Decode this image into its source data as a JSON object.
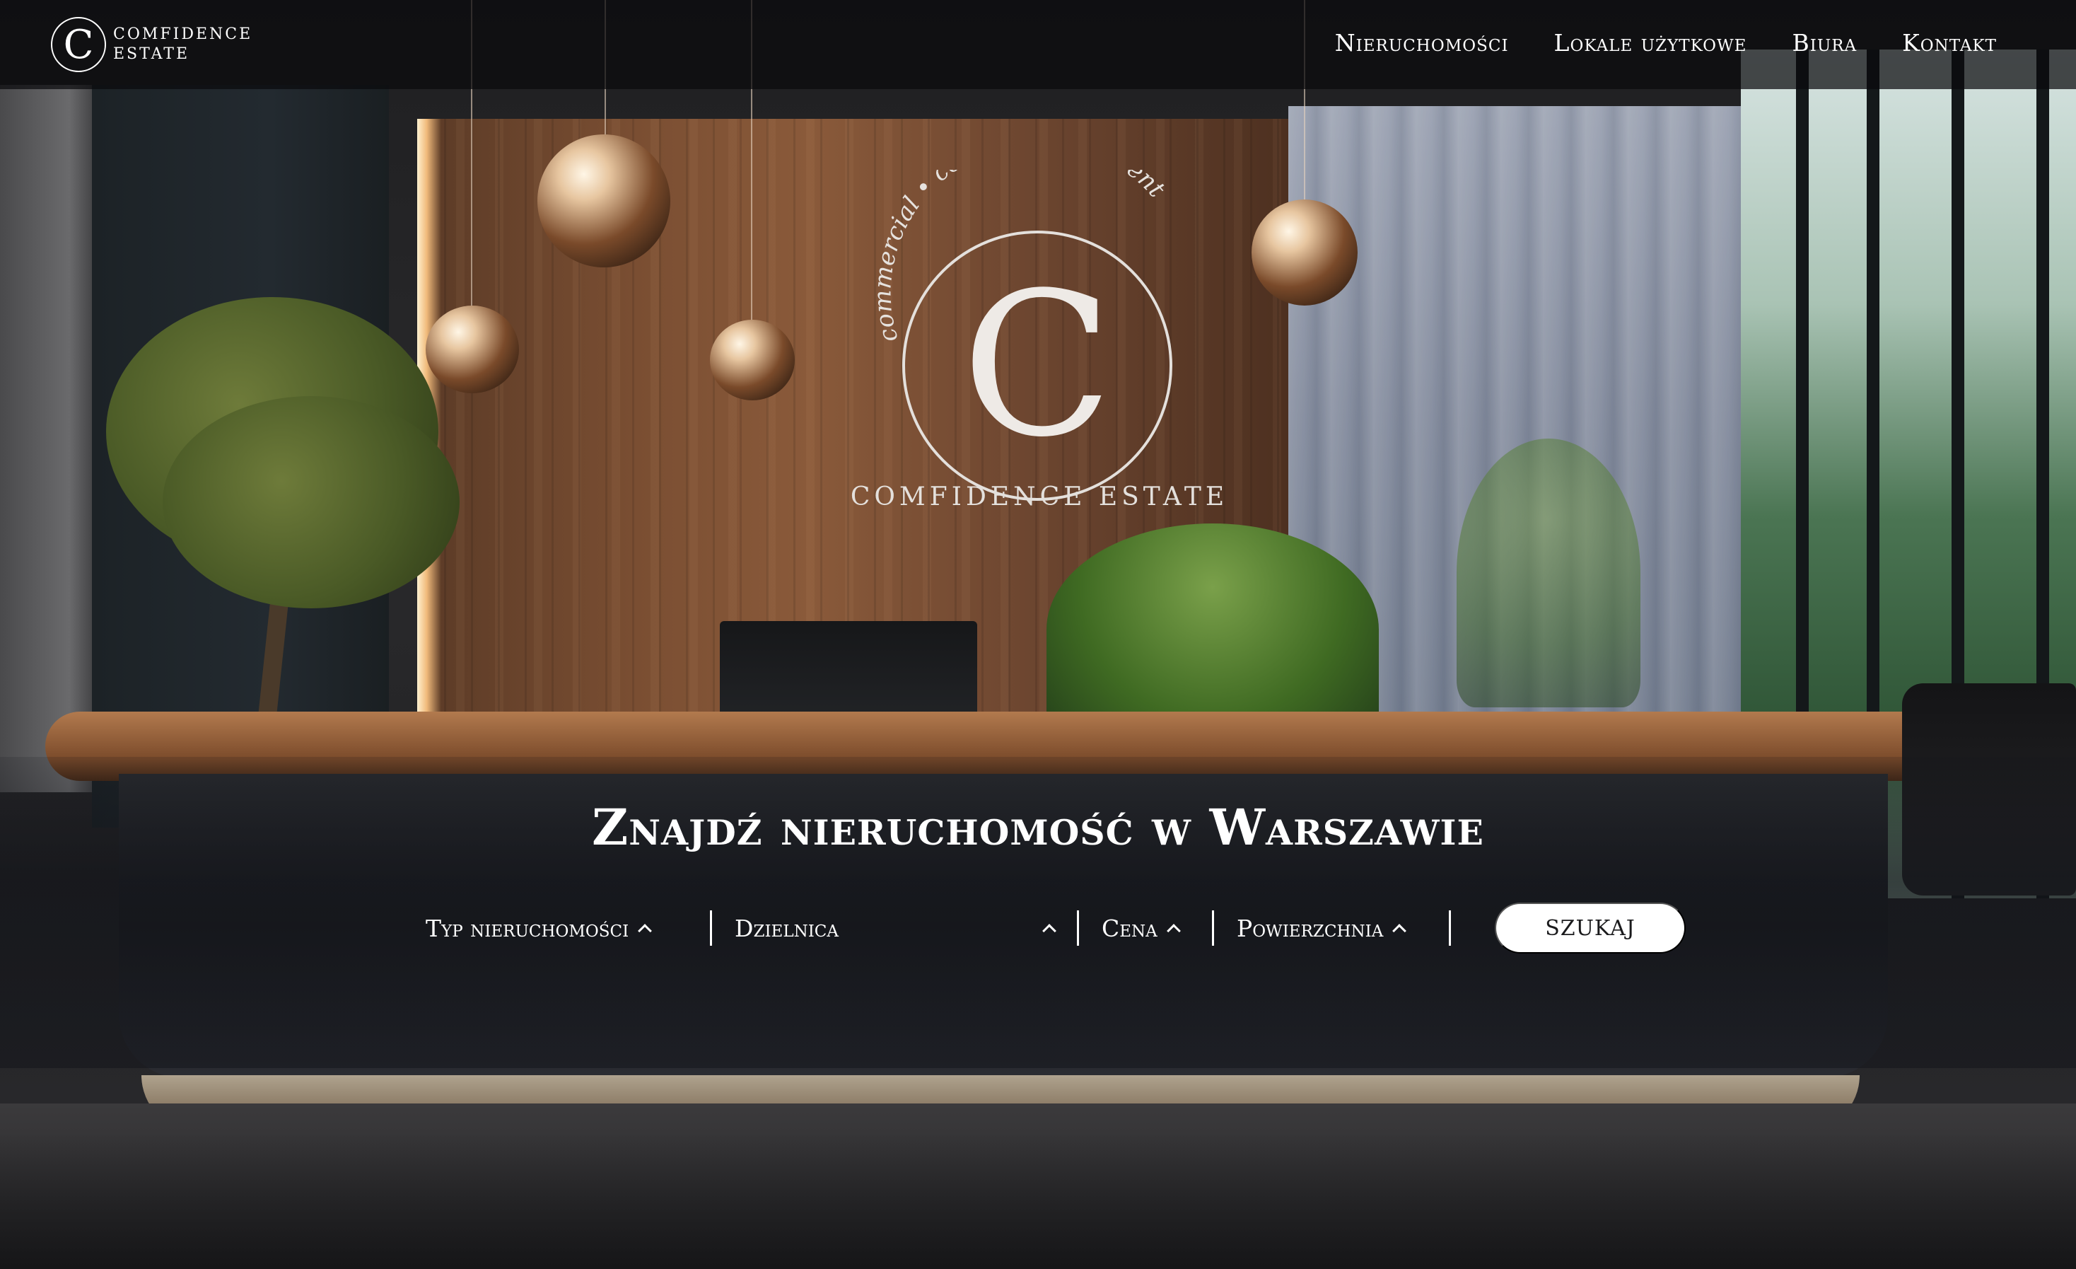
{
  "brand": {
    "mark": "C",
    "line1": "COMFIDENCE",
    "line2": "ESTATE"
  },
  "nav": {
    "items": [
      {
        "label": "Nieruchomości"
      },
      {
        "label": "Lokale użytkowe"
      },
      {
        "label": "Biura"
      },
      {
        "label": "Kontakt"
      }
    ]
  },
  "hero_sign": {
    "mark": "C",
    "arc_text": "commercial • comfort • confident",
    "wordmark": "COMFIDENCE ESTATE"
  },
  "search": {
    "headline": "Znajdź nieruchomość w Warszawie",
    "filters": {
      "type": "Typ nieruchomości",
      "district": "Dzielnica",
      "price": "Cena",
      "area": "Powierzchnia"
    },
    "button": "SZUKAJ"
  },
  "icons": {
    "filter_toggle": "chevron-up-icon"
  },
  "colors": {
    "text": "#ffffff",
    "button_bg": "#ffffff",
    "button_text": "#1a1a1c",
    "header_overlay": "#0a0a0c"
  }
}
